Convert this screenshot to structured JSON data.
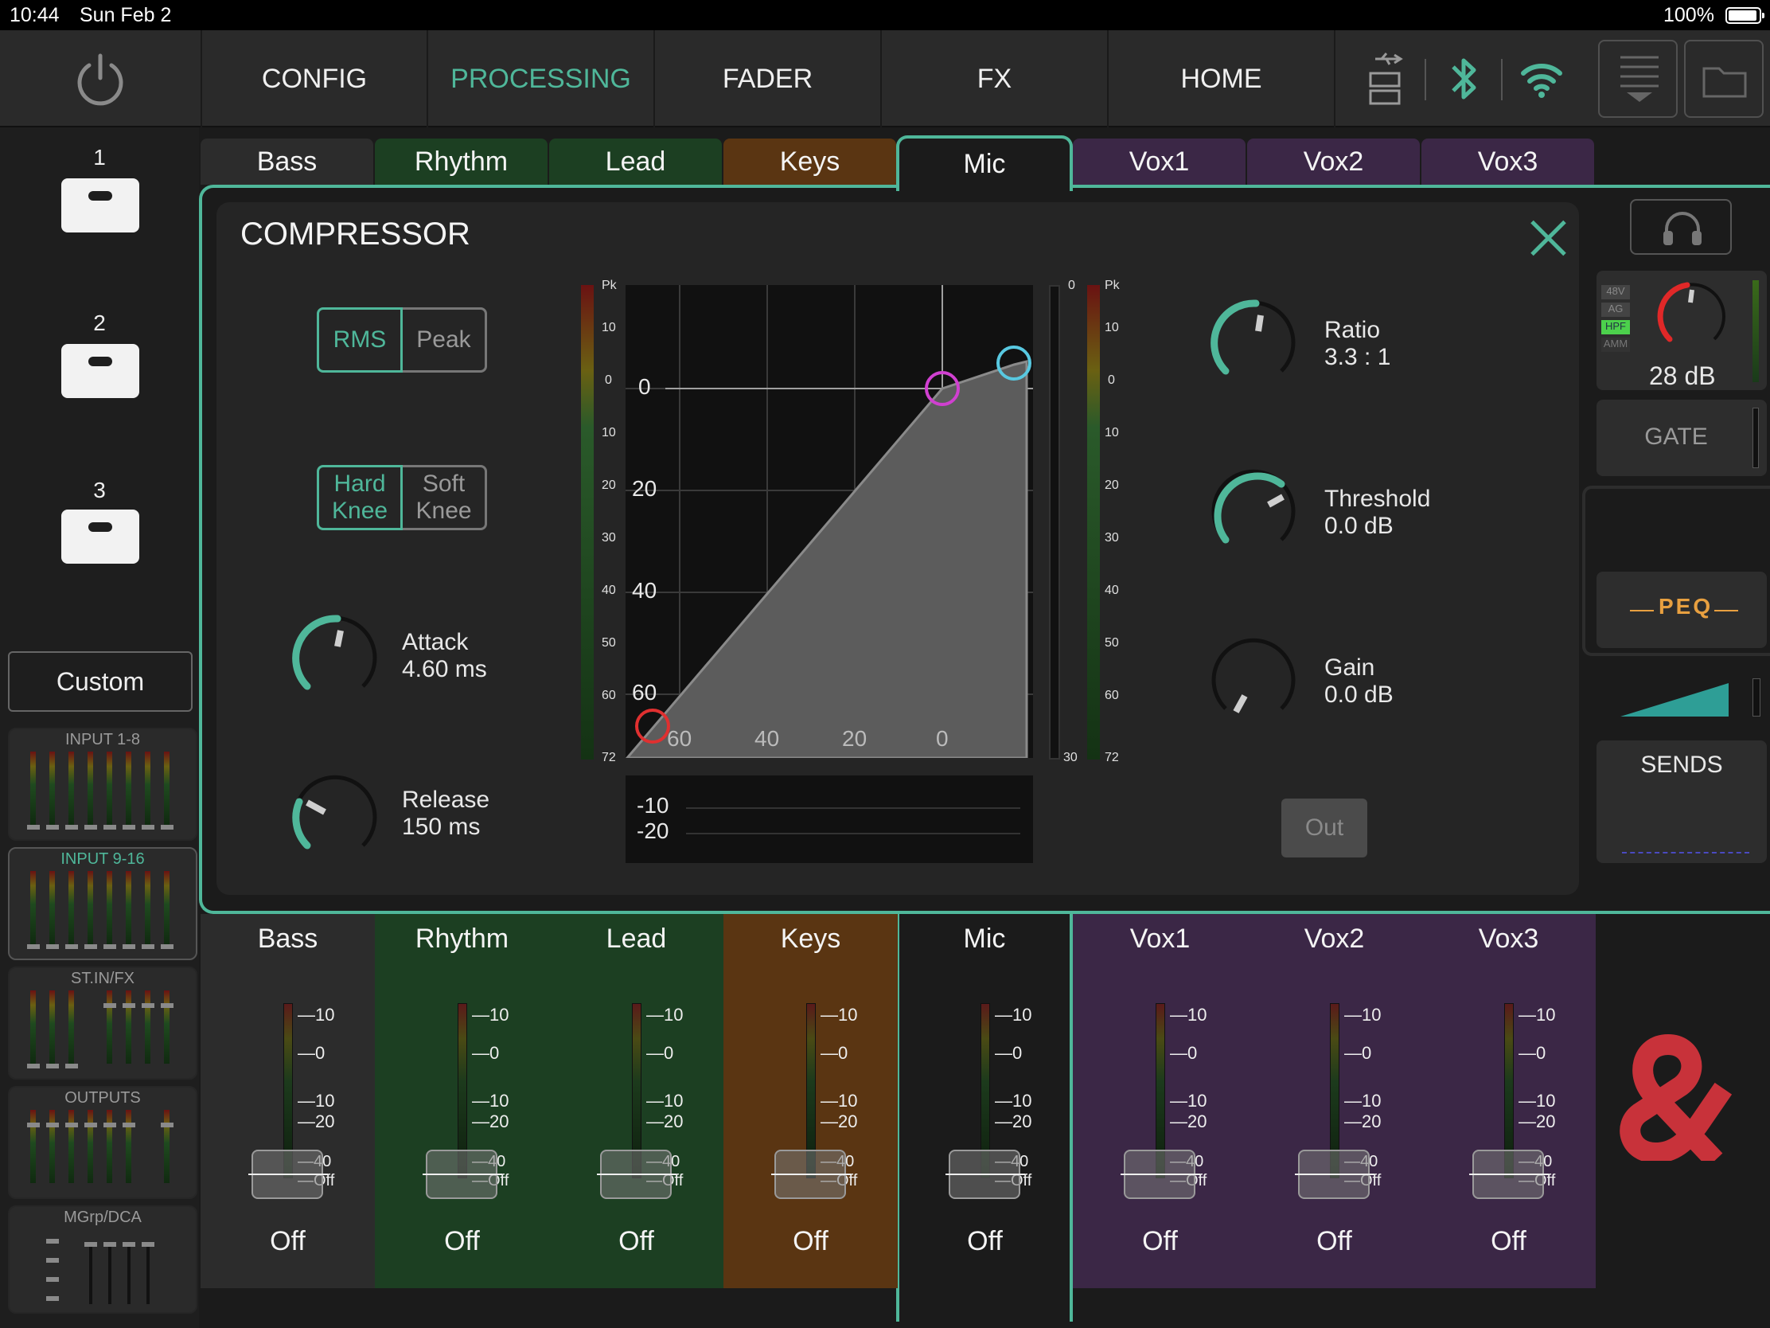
{
  "status_bar": {
    "time": "10:44",
    "date": "Sun Feb 2",
    "battery": "100%"
  },
  "nav": {
    "tabs": [
      {
        "label": "CONFIG",
        "active": false
      },
      {
        "label": "PROCESSING",
        "active": true
      },
      {
        "label": "FADER",
        "active": false
      },
      {
        "label": "FX",
        "active": false
      },
      {
        "label": "HOME",
        "active": false
      }
    ]
  },
  "sidebar": {
    "layers": [
      "1",
      "2",
      "3"
    ],
    "custom_label": "Custom",
    "banks": [
      "INPUT 1-8",
      "INPUT 9-16",
      "ST.IN/FX",
      "OUTPUTS",
      "MGrp/DCA"
    ],
    "selected_bank": "INPUT 9-16"
  },
  "channel_tabs": [
    {
      "label": "Bass",
      "color": "#2c2c2c"
    },
    {
      "label": "Rhythm",
      "color": "#1c3f22"
    },
    {
      "label": "Lead",
      "color": "#1c3f22"
    },
    {
      "label": "Keys",
      "color": "#5a3512"
    },
    {
      "label": "Mic",
      "color": "#252525",
      "selected": true
    },
    {
      "label": "Vox1",
      "color": "#3b2746"
    },
    {
      "label": "Vox2",
      "color": "#3b2746"
    },
    {
      "label": "Vox3",
      "color": "#3b2746"
    }
  ],
  "compressor": {
    "title": "COMPRESSOR",
    "detection": {
      "options": [
        "RMS",
        "Peak"
      ],
      "selected": "RMS"
    },
    "knee": {
      "options": [
        "Hard Knee",
        "Soft Knee"
      ],
      "selected": "Hard Knee"
    },
    "attack": {
      "label": "Attack",
      "value": "4.60 ms"
    },
    "release": {
      "label": "Release",
      "value": "150 ms"
    },
    "ratio": {
      "label": "Ratio",
      "value": "3.3 : 1"
    },
    "threshold": {
      "label": "Threshold",
      "value": "0.0 dB"
    },
    "gain": {
      "label": "Gain",
      "value": "0.0 dB"
    },
    "out_label": "Out",
    "graph": {
      "y_labels": [
        "0",
        "20",
        "40",
        "60"
      ],
      "x_labels": [
        "60",
        "40",
        "20",
        "0"
      ]
    },
    "gr_meter": {
      "labels": [
        "-10",
        "-20"
      ]
    },
    "meter_scale": [
      "Pk",
      "10",
      "0",
      "10",
      "20",
      "30",
      "40",
      "50",
      "60",
      "72"
    ],
    "gr_scale": {
      "top": "0",
      "bottom": "30"
    }
  },
  "right_panel": {
    "preamp_tags": [
      "48V",
      "AG",
      "HPF",
      "AMM"
    ],
    "gain_value": "28 dB",
    "gate_label": "GATE",
    "peq_label": "PEQ",
    "sends_label": "SENDS"
  },
  "fader_strips": [
    {
      "name": "Bass",
      "level": "Off",
      "color": "#2c2c2c"
    },
    {
      "name": "Rhythm",
      "level": "Off",
      "color": "#1c3f22"
    },
    {
      "name": "Lead",
      "level": "Off",
      "color": "#1c3f22"
    },
    {
      "name": "Keys",
      "level": "Off",
      "color": "#5a3512"
    },
    {
      "name": "Mic",
      "level": "Off",
      "color": "#252525"
    },
    {
      "name": "Vox1",
      "level": "Off",
      "color": "#3b2746"
    },
    {
      "name": "Vox2",
      "level": "Off",
      "color": "#3b2746"
    },
    {
      "name": "Vox3",
      "level": "Off",
      "color": "#3b2746"
    }
  ],
  "fader_scale": [
    "10",
    "0",
    "10",
    "20",
    "40",
    "Off"
  ],
  "colors": {
    "accent": "#4fb79a",
    "logo_red": "#c8323a",
    "peq_orange": "#e8a040"
  }
}
